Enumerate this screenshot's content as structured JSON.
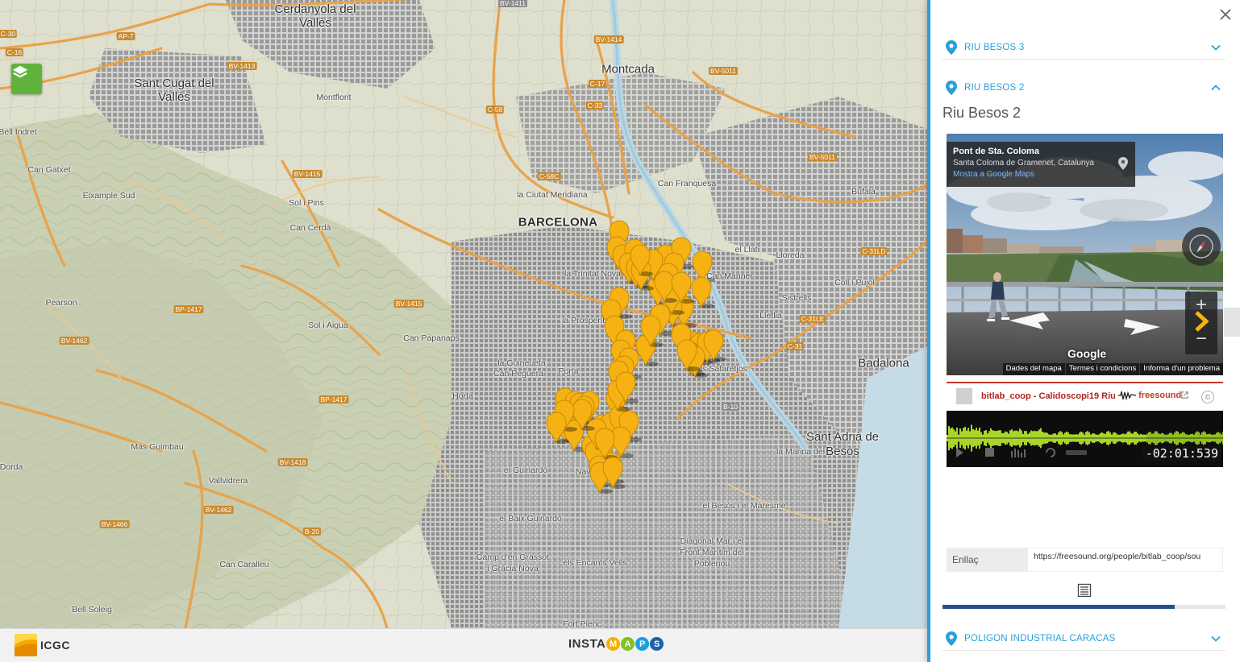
{
  "map": {
    "places": [
      {
        "id": "cerdanyola",
        "label": "Cerdanyola del Vallès",
        "lines": [
          "Cerdanyola del",
          "Vallès"
        ],
        "kind": "city"
      },
      {
        "id": "montcada",
        "label": "Montcada",
        "kind": "city"
      },
      {
        "id": "sant-cugat",
        "label": "Sant Cugat del Vallès",
        "lines": [
          "Sant Cugat del",
          "Vallès"
        ],
        "kind": "city"
      },
      {
        "id": "montflorit",
        "label": "Montflorit",
        "kind": "small"
      },
      {
        "id": "bell-indret",
        "label": "Bell Indret",
        "kind": "small"
      },
      {
        "id": "can-gatxet",
        "label": "Can Gatxet",
        "kind": "small"
      },
      {
        "id": "eixample-sud",
        "label": "Eixample Sud",
        "kind": "small"
      },
      {
        "id": "sol-i-pins",
        "label": "Sol i Pins",
        "kind": "small"
      },
      {
        "id": "can-cerda",
        "label": "Can Cerdà",
        "kind": "small"
      },
      {
        "id": "pearson",
        "label": "Pearson",
        "kind": "small"
      },
      {
        "id": "sol-i-aigua",
        "label": "Sol i Aigua",
        "kind": "small"
      },
      {
        "id": "can-papanaps",
        "label": "Can Papanaps",
        "kind": "small"
      },
      {
        "id": "la-guineueta",
        "label": "la Guineueta",
        "kind": "small"
      },
      {
        "id": "can-peguera",
        "label": "Can Peguera",
        "kind": "small"
      },
      {
        "id": "porta",
        "label": "Porta",
        "kind": "small"
      },
      {
        "id": "horta",
        "label": "Horta",
        "kind": "small"
      },
      {
        "id": "mas-guimbau",
        "label": "Mas Guimbau",
        "kind": "small"
      },
      {
        "id": "vallvidrera",
        "label": "Vallvidrera",
        "kind": "small"
      },
      {
        "id": "dorda",
        "label": "Dorda",
        "kind": "small"
      },
      {
        "id": "can-caralleu",
        "label": "Can Caralleu",
        "kind": "small"
      },
      {
        "id": "bell-soleig",
        "label": "Bell Soleig",
        "kind": "small"
      },
      {
        "id": "barcelona",
        "label": "BARCELONA",
        "kind": "big"
      },
      {
        "id": "ciutat-meridiana",
        "label": "la Ciutat Meridiana",
        "kind": "small"
      },
      {
        "id": "can-franquesa",
        "label": "Can Franquesa",
        "kind": "small"
      },
      {
        "id": "bufala",
        "label": "Bufalà",
        "kind": "small"
      },
      {
        "id": "la-trinitat-nova",
        "label": "la Trinitat Nova",
        "kind": "small"
      },
      {
        "id": "el-llati",
        "label": "el Llatí",
        "kind": "small"
      },
      {
        "id": "lloreda",
        "label": "Lloreda",
        "kind": "small"
      },
      {
        "id": "can-manner",
        "label": "Can Manner",
        "kind": "small"
      },
      {
        "id": "coll-i-pujol",
        "label": "Coll i Pujol",
        "kind": "small"
      },
      {
        "id": "sistrells",
        "label": "Sistrells",
        "kind": "small"
      },
      {
        "id": "lleflia",
        "label": "Lleflia",
        "kind": "small"
      },
      {
        "id": "la-prosperitat",
        "label": "la Prosperitat",
        "kind": "small"
      },
      {
        "id": "els-safaretjos",
        "label": "els Safaretjos",
        "kind": "small"
      },
      {
        "id": "badalona",
        "label": "Badalona",
        "kind": "city"
      },
      {
        "id": "sant-adria",
        "label": "Sant Adrià de Besòs",
        "lines": [
          "Sant Adrià de",
          "Besòs"
        ],
        "kind": "city"
      },
      {
        "id": "la-marina-del-besos",
        "label": "la Marina del",
        "kind": "small"
      },
      {
        "id": "el-guinardo",
        "label": "el Guinardó",
        "kind": "small"
      },
      {
        "id": "el-besos-maresme",
        "label": "el Besòs i el Maresme",
        "kind": "small"
      },
      {
        "id": "el-baix-guinardo",
        "label": "el Baix Guinardó",
        "kind": "small"
      },
      {
        "id": "diagonal-mar",
        "label": "Diagonal Mar i el Front Marítim del Poblenou",
        "lines": [
          "Diagonal Mar i el",
          "Front Marítim del",
          "Poblenou"
        ],
        "kind": "small"
      },
      {
        "id": "camp-grassot",
        "label": "Camp d'en Grassot i Gràcia Nova",
        "lines": [
          "Camp d'en Grassot",
          "i Gràcia Nova"
        ],
        "kind": "small"
      },
      {
        "id": "els-encants-vells",
        "label": "els Encants Vells",
        "kind": "small"
      },
      {
        "id": "fort-pienc",
        "label": "Fort Pienc",
        "kind": "small"
      },
      {
        "id": "nava",
        "label": "Nava",
        "kind": "small"
      }
    ],
    "roads": [
      "C-30",
      "AP-7",
      "BV-1411",
      "BV-1413",
      "C-16",
      "BV-1414",
      "BV-1415",
      "C-17",
      "C-58",
      "C-33",
      "C-58C",
      "BV-5011",
      "BV-5011",
      "C-31LD",
      "BV-1415",
      "BP-1417",
      "BV-1462",
      "BP-1417",
      "BV-1418",
      "BV-1466",
      "BV-1462",
      "B-20",
      "C-31",
      "C-31LE",
      "B-10"
    ],
    "marker_color": "#f6b213",
    "marker_count": 71
  },
  "layer_button": {
    "icon": "layers-icon"
  },
  "footer": {
    "icgc_label": "ICGC",
    "instamaps_prefix": "INSTA",
    "instamaps_letters": [
      {
        "char": "M",
        "color": "#f5b100"
      },
      {
        "char": "A",
        "color": "#83c11f"
      },
      {
        "char": "P",
        "color": "#1aa0dc"
      },
      {
        "char": "S",
        "color": "#1c62a8"
      }
    ]
  },
  "panel": {
    "accent": "#2a9fd8",
    "items": [
      {
        "label": "RIU BESOS 3",
        "expanded": false
      },
      {
        "label": "RIU BESOS 2",
        "expanded": true
      },
      {
        "label": "POLIGON INDUSTRIAL CARACAS",
        "expanded": false
      }
    ],
    "detail": {
      "title": "Riu Besos 2",
      "streetview": {
        "place_name": "Pont de Sta. Coloma",
        "place_address": "Santa Coloma de Gramenet, Catalunya",
        "maps_link": "Mostra a Google Maps",
        "google_logo": "Google",
        "footer_links": [
          "Dades del mapa",
          "Termes i condicions",
          "Informa d'un problema"
        ]
      },
      "freesound": {
        "track_name": "bitlab_coop - Calidoscopi19 Riu",
        "logo": "freesound",
        "time": "-02:01:539"
      },
      "link_label": "Enllaç",
      "link_value": "https://freesound.org/people/bitlab_coop/sou"
    },
    "progress": 0.82
  }
}
